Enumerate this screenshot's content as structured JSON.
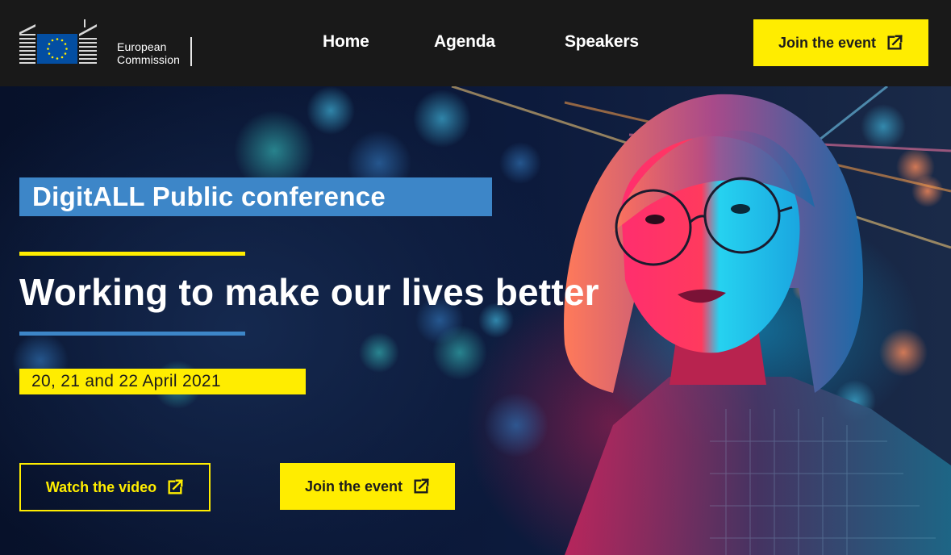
{
  "header": {
    "logo_line1": "European",
    "logo_line2": "Commission",
    "logo_icon": "eu-flag-building-icon",
    "nav": [
      {
        "label": "Home"
      },
      {
        "label": "Agenda"
      },
      {
        "label": "Speakers"
      }
    ],
    "join_label": "Join the event",
    "join_icon": "external-link-icon"
  },
  "hero": {
    "tag": "DigitALL Public conference",
    "headline": "Working to make our lives better",
    "date": "20, 21 and 22 April 2021",
    "watch_label": "Watch the video",
    "watch_icon": "external-link-icon",
    "join_label": "Join the event",
    "join_icon": "external-link-icon",
    "image": "portrait-with-neon-lights"
  },
  "colors": {
    "header_bg": "#191919",
    "accent_yellow": "#ffed00",
    "accent_blue": "#3d86c8",
    "eu_blue": "#034ea2"
  }
}
